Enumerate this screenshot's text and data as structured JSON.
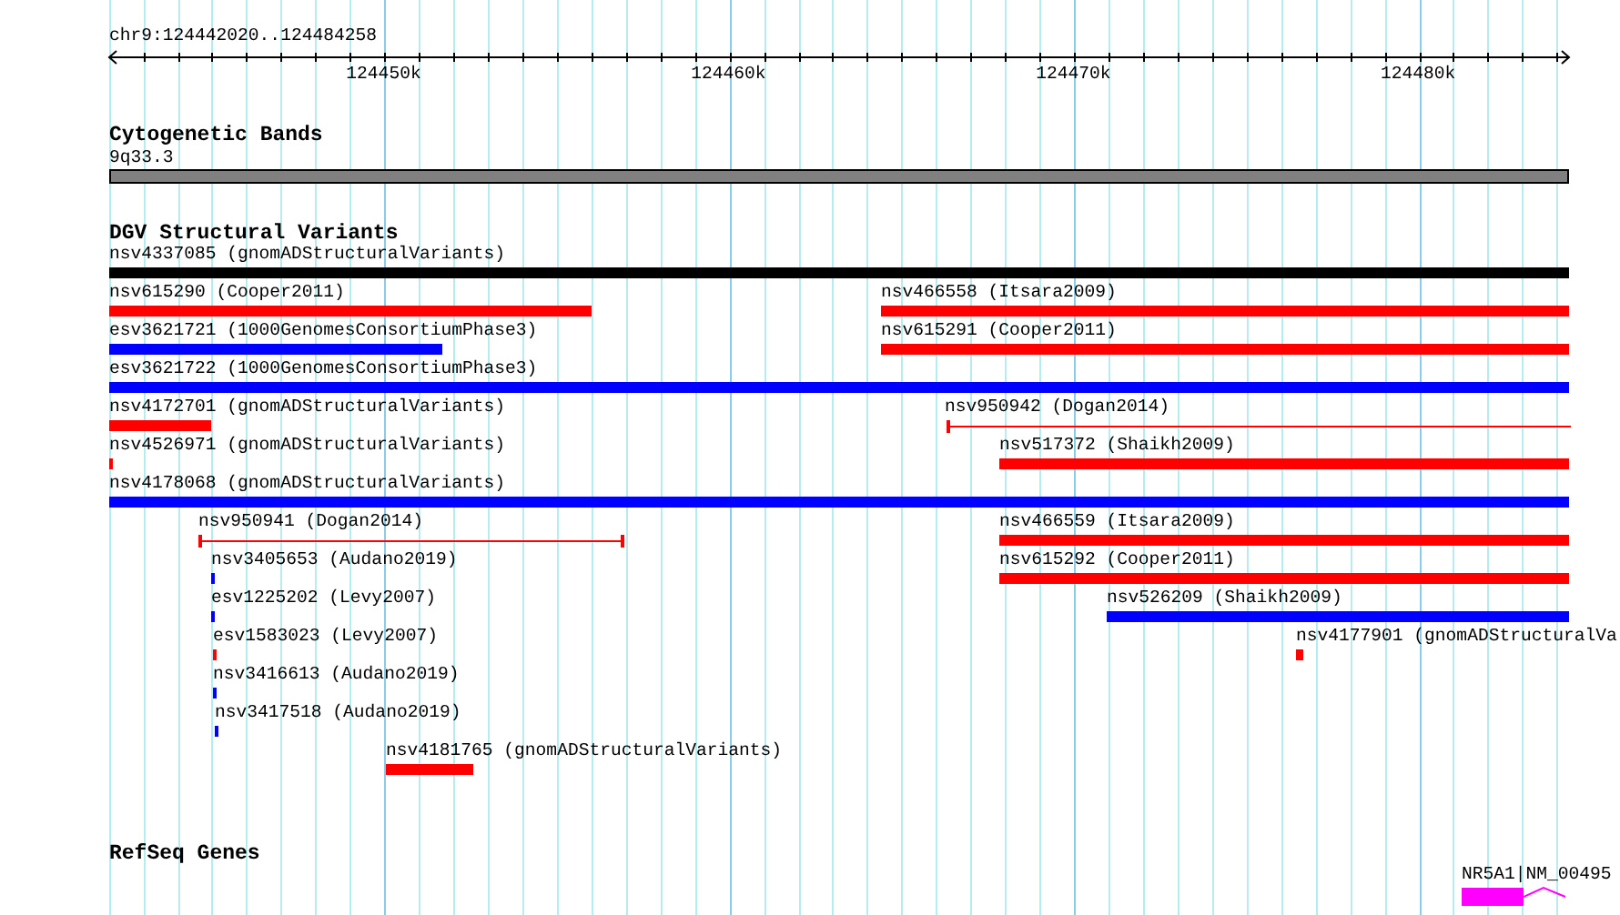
{
  "ruler": {
    "location": "chr9:124442020..124484258",
    "tick_labels": [
      "124450k",
      "124460k",
      "124470k",
      "124480k"
    ]
  },
  "tracks": [
    {
      "title": "Cytogenetic Bands",
      "features": [
        {
          "label": "9q33.3",
          "kind": "band",
          "color": "#808080"
        }
      ]
    },
    {
      "title": "DGV Structural Variants",
      "features": [
        {
          "label": "nsv4337085 (gnomADStructuralVariants)",
          "kind": "bar",
          "color": "#000000"
        },
        {
          "label": "nsv615290 (Cooper2011)",
          "kind": "bar",
          "color": "#ff0000"
        },
        {
          "label": "nsv466558 (Itsara2009)",
          "kind": "bar",
          "color": "#ff0000"
        },
        {
          "label": "esv3621721 (1000GenomesConsortiumPhase3)",
          "kind": "bar",
          "color": "#0000ff"
        },
        {
          "label": "nsv615291 (Cooper2011)",
          "kind": "bar",
          "color": "#ff0000"
        },
        {
          "label": "esv3621722 (1000GenomesConsortiumPhase3)",
          "kind": "bar",
          "color": "#0000ff"
        },
        {
          "label": "nsv4172701 (gnomADStructuralVariants)",
          "kind": "bar",
          "color": "#ff0000"
        },
        {
          "label": "nsv950942 (Dogan2014)",
          "kind": "span",
          "color": "#ff0000"
        },
        {
          "label": "nsv4526971 (gnomADStructuralVariants)",
          "kind": "bar",
          "color": "#ff0000"
        },
        {
          "label": "nsv517372 (Shaikh2009)",
          "kind": "bar",
          "color": "#ff0000"
        },
        {
          "label": "nsv4178068 (gnomADStructuralVariants)",
          "kind": "bar",
          "color": "#0000ff"
        },
        {
          "label": "nsv950941 (Dogan2014)",
          "kind": "span",
          "color": "#ff0000"
        },
        {
          "label": "nsv466559 (Itsara2009)",
          "kind": "bar",
          "color": "#ff0000"
        },
        {
          "label": "nsv3405653 (Audano2019)",
          "kind": "bar",
          "color": "#0000ff"
        },
        {
          "label": "nsv615292 (Cooper2011)",
          "kind": "bar",
          "color": "#ff0000"
        },
        {
          "label": "esv1225202 (Levy2007)",
          "kind": "bar",
          "color": "#0000ff"
        },
        {
          "label": "nsv526209 (Shaikh2009)",
          "kind": "bar",
          "color": "#0000ff"
        },
        {
          "label": "esv1583023 (Levy2007)",
          "kind": "bar",
          "color": "#ff0000"
        },
        {
          "label": "nsv4177901 (gnomADStructuralVa",
          "kind": "bar",
          "color": "#ff0000"
        },
        {
          "label": "nsv3416613 (Audano2019)",
          "kind": "bar",
          "color": "#0000ff"
        },
        {
          "label": "nsv3417518 (Audano2019)",
          "kind": "bar",
          "color": "#0000ff"
        },
        {
          "label": "nsv4181765 (gnomADStructuralVariants)",
          "kind": "bar",
          "color": "#ff0000"
        }
      ]
    },
    {
      "title": "RefSeq Genes",
      "features": [
        {
          "label": "NR5A1|NM_00495",
          "kind": "gene",
          "color": "#ff00ff"
        }
      ]
    }
  ]
}
